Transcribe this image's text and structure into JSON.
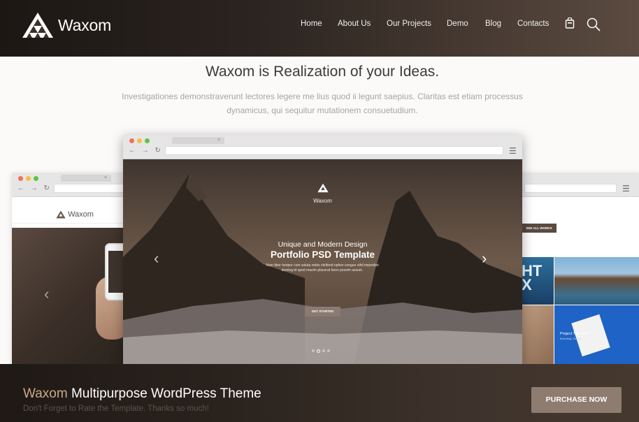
{
  "header": {
    "logo_text": "Waxom",
    "nav": [
      "Home",
      "About Us",
      "Our Projects",
      "Demo",
      "Blog",
      "Contacts"
    ],
    "icons": [
      "cart-icon",
      "search-icon"
    ]
  },
  "intro": {
    "title": "Waxom is Realization of your Ideas.",
    "text": "Investigationes demonstraverunt lectores legere me lius quod ii legunt saepius. Claritas est etiam processus dynamicus, qui sequitur mutationem consuetudium."
  },
  "mock_left": {
    "logo_text": "Waxom"
  },
  "mock_main": {
    "logo_text": "Waxom",
    "subtitle": "Unique and Modern Design",
    "title": "Portfolio PSD Template",
    "description": "Nam liber tempor cum soluta nobis eleifend option congue nihil imperdiet doming id quod mazim placerat facer possim assum.",
    "button": "GET STARTED",
    "slide_count": 4,
    "active_slide": 2
  },
  "mock_right": {
    "see_all": "SEE ALL WORKS",
    "project_title": "Project Title Here",
    "project_category": "Branding, Design",
    "tile_text": "HT\nX"
  },
  "footer_cta": {
    "accent": "Waxom",
    "title": " Multipurpose WordPress Theme",
    "subtitle": "Don't Forget to Rate the Template. Thanks so much!",
    "button": "PURCHASE NOW"
  },
  "colors": {
    "accent": "#c8a88a",
    "button": "#8e7c71",
    "dark": "#1f1915"
  }
}
